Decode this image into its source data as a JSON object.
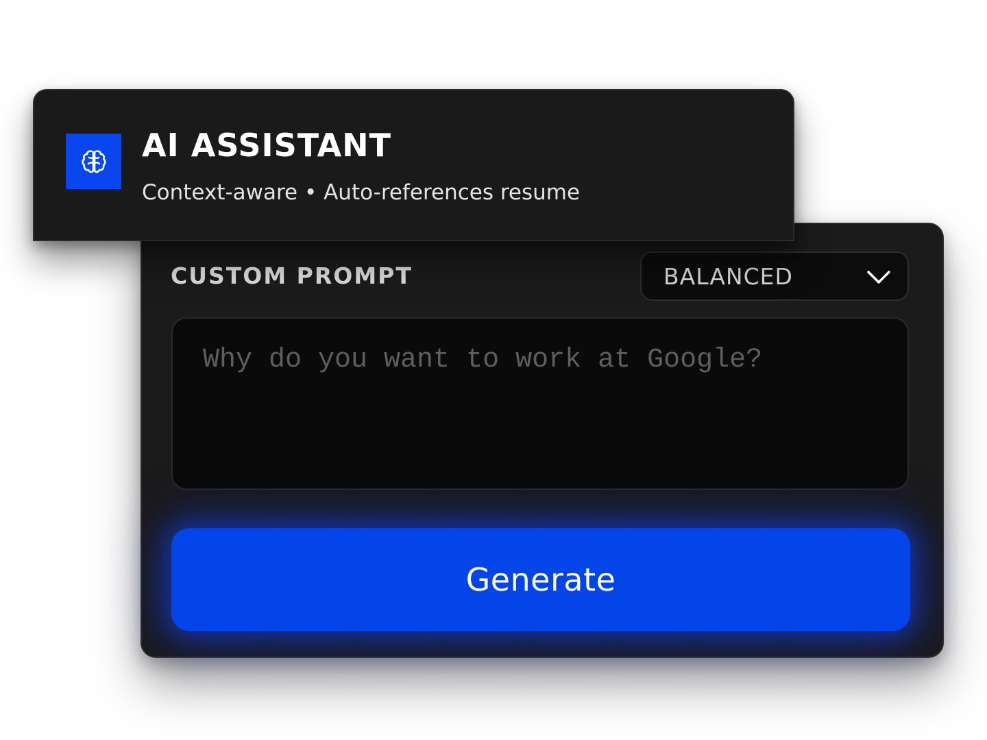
{
  "header": {
    "icon": "brain-icon",
    "title": "AI ASSISTANT",
    "subtitle": "Context-aware • Auto-references resume"
  },
  "prompt_panel": {
    "label": "CUSTOM PROMPT",
    "mode_select": {
      "selected": "BALANCED",
      "icon": "chevron-down-icon"
    },
    "input": {
      "value": "",
      "placeholder": "Why do you want to work at Google?"
    },
    "generate_label": "Generate"
  },
  "colors": {
    "accent": "#0445ea",
    "card_bg": "#1b1b1c",
    "input_bg": "#0a0a0a"
  }
}
